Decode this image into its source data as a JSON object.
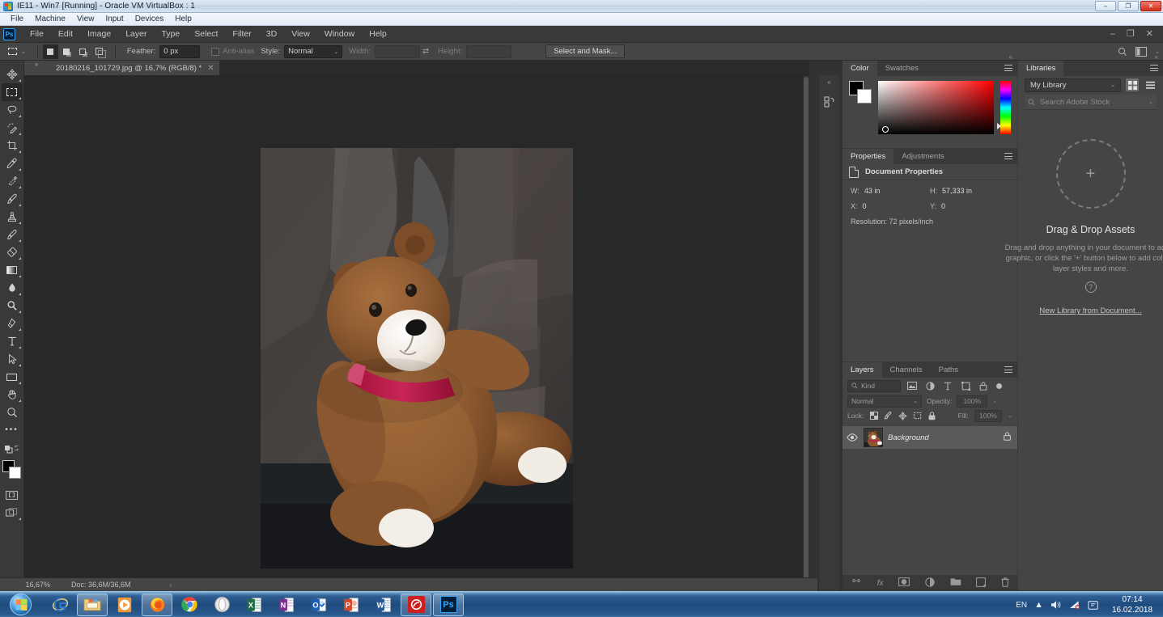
{
  "vbox": {
    "title": "IE11 - Win7 [Running] - Oracle VM VirtualBox : 1",
    "menu": [
      "File",
      "Machine",
      "View",
      "Input",
      "Devices",
      "Help"
    ],
    "window_controls": {
      "minimize": "–",
      "restore": "❐",
      "close": "✕"
    }
  },
  "photoshop": {
    "logo": "Ps",
    "menu": [
      "File",
      "Edit",
      "Image",
      "Layer",
      "Type",
      "Select",
      "Filter",
      "3D",
      "View",
      "Window",
      "Help"
    ],
    "window_controls": {
      "minimize": "–",
      "restore": "❐",
      "close": "✕"
    },
    "options_bar": {
      "tool_icon": "rectangular-marquee-icon",
      "tool_preset_caret": "⌄",
      "selection_modes": [
        "new-selection",
        "add-to-selection",
        "subtract-from-selection",
        "intersect-with-selection"
      ],
      "feather_label": "Feather:",
      "feather_value": "0 px",
      "antialias_label": "Anti-alias",
      "style_label": "Style:",
      "style_value": "Normal",
      "width_label": "Width:",
      "width_value": "",
      "height_label": "Height:",
      "height_value": "",
      "swap_icon": "swap-width-height-icon",
      "select_and_mask": "Select and Mask...",
      "search_icon": "search-icon",
      "workspace_icon": "workspace-switcher-icon",
      "workspace_caret": "⌄"
    },
    "document_tab": {
      "label": "20180216_101729.jpg @ 16,7% (RGB/8) *",
      "close": "✕"
    },
    "tools": [
      {
        "name": "move-tool",
        "label": "Move Tool"
      },
      {
        "name": "rectangular-marquee-tool",
        "label": "Rectangular Marquee Tool"
      },
      {
        "name": "lasso-tool",
        "label": "Lasso Tool"
      },
      {
        "name": "quick-selection-tool",
        "label": "Quick Selection Tool"
      },
      {
        "name": "crop-tool",
        "label": "Crop Tool"
      },
      {
        "name": "eyedropper-tool",
        "label": "Eyedropper Tool"
      },
      {
        "name": "spot-healing-brush-tool",
        "label": "Spot Healing Brush Tool"
      },
      {
        "name": "brush-tool",
        "label": "Brush Tool"
      },
      {
        "name": "clone-stamp-tool",
        "label": "Clone Stamp Tool"
      },
      {
        "name": "history-brush-tool",
        "label": "History Brush Tool"
      },
      {
        "name": "eraser-tool",
        "label": "Eraser Tool"
      },
      {
        "name": "gradient-tool",
        "label": "Gradient Tool"
      },
      {
        "name": "blur-tool",
        "label": "Blur Tool"
      },
      {
        "name": "dodge-tool",
        "label": "Dodge Tool"
      },
      {
        "name": "pen-tool",
        "label": "Pen Tool"
      },
      {
        "name": "type-tool",
        "label": "Horizontal Type Tool"
      },
      {
        "name": "path-selection-tool",
        "label": "Path Selection Tool"
      },
      {
        "name": "rectangle-tool",
        "label": "Rectangle Tool"
      },
      {
        "name": "hand-tool",
        "label": "Hand Tool"
      },
      {
        "name": "zoom-tool",
        "label": "Zoom Tool"
      },
      {
        "name": "edit-toolbar-tool",
        "label": "Edit Toolbar"
      }
    ],
    "active_tool": "rectangular-marquee-tool",
    "foreground_color": "#000000",
    "background_color": "#ffffff",
    "quick_mask_icon": "quick-mask-icon",
    "screen_mode_icon": "screen-mode-icon",
    "status_bar": {
      "zoom": "16,67%",
      "doc_info": "Doc: 36,6M/36,6M",
      "arrow": "›"
    }
  },
  "panels": {
    "color": {
      "tabs": [
        "Color",
        "Swatches"
      ],
      "active_tab": "Color",
      "menu_icon": "panel-menu-icon",
      "collapse_icon": "collapse-panels-icon",
      "foreground": "#000000",
      "background": "#ffffff",
      "hue": "#ff0000"
    },
    "properties": {
      "tabs": [
        "Properties",
        "Adjustments"
      ],
      "active_tab": "Properties",
      "menu_icon": "panel-menu-icon",
      "heading": "Document Properties",
      "doc_icon": "document-icon",
      "fields": [
        {
          "key": "W:",
          "value": "43 in"
        },
        {
          "key": "H:",
          "value": "57,333 in"
        },
        {
          "key": "X:",
          "value": "0"
        },
        {
          "key": "Y:",
          "value": "0"
        }
      ],
      "resolution": "Resolution: 72 pixels/inch"
    },
    "layers": {
      "tabs": [
        "Layers",
        "Channels",
        "Paths"
      ],
      "active_tab": "Layers",
      "menu_icon": "panel-menu-icon",
      "filter": {
        "kind_label": "Kind",
        "search_icon": "search-icon",
        "caret": "⌄",
        "icons": [
          "pixel-layer-filter-icon",
          "adjustment-layer-filter-icon",
          "type-layer-filter-icon",
          "shape-layer-filter-icon",
          "smart-object-filter-icon"
        ],
        "toggle": "filter-toggle-icon"
      },
      "blend_mode": "Normal",
      "blend_caret": "⌄",
      "opacity_label": "Opacity:",
      "opacity_value": "100%",
      "lock_label": "Lock:",
      "lock_icons": [
        "lock-transparent-pixels-icon",
        "lock-image-pixels-icon",
        "lock-position-icon",
        "lock-artboard-icon",
        "lock-all-icon"
      ],
      "fill_label": "Fill:",
      "fill_value": "100%",
      "rows": [
        {
          "name": "Background",
          "visible": true,
          "locked": true,
          "lock_icon": "lock-icon",
          "eye_icon": "eye-icon"
        }
      ],
      "footer_icons": [
        "link-layers-icon",
        "layer-style-fx-icon",
        "add-layer-mask-icon",
        "new-adjustment-layer-icon",
        "new-group-icon",
        "new-layer-icon",
        "delete-layer-icon"
      ],
      "fx_label": "fx"
    },
    "libraries": {
      "tabs": [
        "Libraries"
      ],
      "active_tab": "Libraries",
      "menu_icon": "panel-menu-icon",
      "library_select": "My Library",
      "library_caret": "⌄",
      "view_grid_icon": "grid-view-icon",
      "view_list_icon": "list-view-icon",
      "search_placeholder": "Search Adobe Stock",
      "search_icon": "search-icon",
      "search_caret": "⌄",
      "dropzone_plus": "+",
      "dropzone_title": "Drag & Drop Assets",
      "dropzone_text": "Drag and drop anything in your document to add a graphic, or click the '+' button below to add colors, layer styles and more.",
      "help_icon": "help-icon",
      "help_glyph": "?",
      "new_library_link": "New Library from Document...",
      "footer_icons": [
        "add-content-icon",
        "upload-icon",
        "sync-icon",
        "delete-icon"
      ]
    }
  },
  "canvas": {
    "image_title": "teddy-bear-photo",
    "zoom_percent": "16,67%"
  },
  "taskbar": {
    "start_label": "Start",
    "items": [
      {
        "name": "taskbar-item-internet-explorer",
        "label": "e",
        "icon": "internet-explorer-icon",
        "color": "#1a7fd4",
        "open": false
      },
      {
        "name": "taskbar-item-windows-explorer",
        "label": "",
        "icon": "folder-icon",
        "color": "#e8b54a",
        "open": true
      },
      {
        "name": "taskbar-item-media-player",
        "label": "▶",
        "icon": "media-player-icon",
        "color": "#e8871a",
        "open": false
      },
      {
        "name": "taskbar-item-firefox",
        "label": "",
        "icon": "firefox-icon",
        "color": "#e8651a",
        "open": true
      },
      {
        "name": "taskbar-item-chrome",
        "label": "",
        "icon": "chrome-icon",
        "color": "#4285f4",
        "open": false
      },
      {
        "name": "taskbar-item-opera",
        "label": "O",
        "icon": "opera-icon",
        "color": "#d9d9d9",
        "open": false
      },
      {
        "name": "taskbar-item-excel",
        "label": "X",
        "icon": "excel-icon",
        "color": "#1d7044",
        "open": false
      },
      {
        "name": "taskbar-item-onenote",
        "label": "N",
        "icon": "onenote-icon",
        "color": "#7b2f8e",
        "open": false
      },
      {
        "name": "taskbar-item-outlook",
        "label": "O",
        "icon": "outlook-icon",
        "color": "#1a5fb4",
        "open": false
      },
      {
        "name": "taskbar-item-powerpoint",
        "label": "P",
        "icon": "powerpoint-icon",
        "color": "#d24726",
        "open": false
      },
      {
        "name": "taskbar-item-word",
        "label": "W",
        "icon": "word-icon",
        "color": "#2b579a",
        "open": false
      },
      {
        "name": "taskbar-item-red-app",
        "label": "◎",
        "icon": "red-app-icon",
        "color": "#cc1f1f",
        "open": true
      },
      {
        "name": "taskbar-item-photoshop",
        "label": "Ps",
        "icon": "photoshop-icon",
        "color": "#001e36",
        "open": true
      }
    ],
    "tray": {
      "language": "EN",
      "show_hidden_icon": "show-hidden-icons-icon",
      "volume_icon": "volume-icon",
      "network_icon": "network-icon",
      "action_center_icon": "action-center-icon",
      "time": "07:14",
      "date": "16.02.2018"
    }
  }
}
